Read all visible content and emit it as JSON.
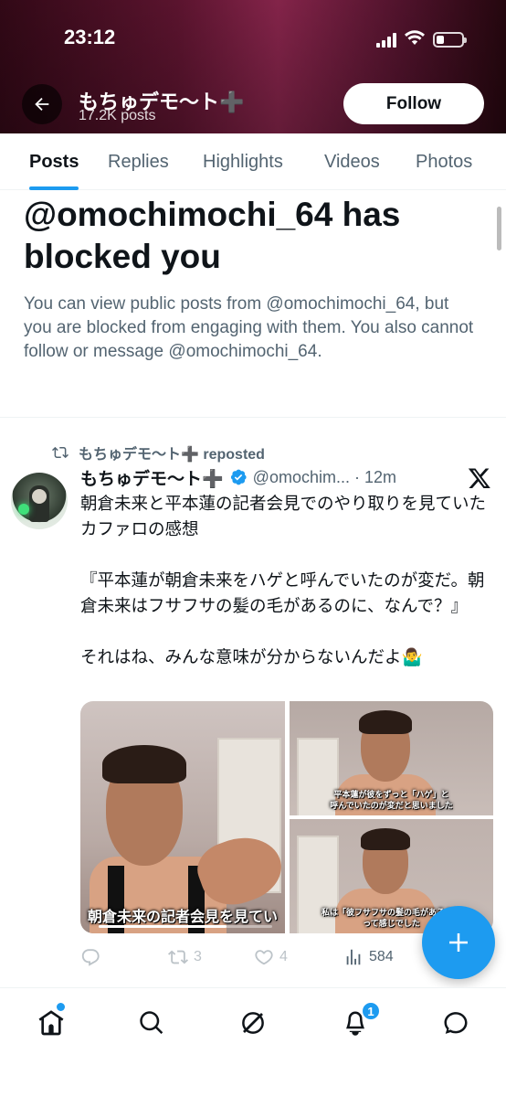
{
  "status_bar": {
    "time": "23:12"
  },
  "header": {
    "profile_name": "もちゅデモ〜ト➕",
    "post_count": "17.2K posts",
    "follow_label": "Follow"
  },
  "tabs": [
    {
      "label": "Posts",
      "active": true
    },
    {
      "label": "Replies",
      "active": false
    },
    {
      "label": "Highlights",
      "active": false
    },
    {
      "label": "Videos",
      "active": false
    },
    {
      "label": "Photos",
      "active": false
    }
  ],
  "blocked": {
    "title": "@omochimochi_64 has blocked you",
    "description": "You can view public posts from @omochimochi_64, but you are blocked from engaging with them. You also cannot follow or message @omochimochi_64."
  },
  "tweet": {
    "repost_label": "もちゅデモ〜ト➕ reposted",
    "author_name": "もちゅデモ〜ト➕",
    "handle_time": "@omochim... · 12m",
    "text": "朝倉未来と平本蓮の記者会見でのやり取りを見ていたカファロの感想\n\n『平本蓮が朝倉未来をハゲと呼んでいたのが変だ。朝倉未来はフサフサの髪の毛があるのに、なんで？』\n\nそれはね、みんな意味が分からないんだよ🤷‍♂️",
    "media": {
      "main_caption": "朝倉未来の記者会見を見てい",
      "top_right_caption_1": "平本蓮が彼をずっと「ハゲ」と",
      "top_right_caption_2": "呼んでいたのが変だと思いました",
      "bottom_right_caption_1": "私は「彼フサフサの髪の毛があるのに",
      "bottom_right_caption_2": "って感じでした"
    },
    "reposts": "3",
    "likes": "4",
    "views": "584"
  },
  "bottom_nav": {
    "notification_count": "1"
  },
  "colors": {
    "accent": "#1d9bf0",
    "text_primary": "#0f1419",
    "text_secondary": "#536471"
  }
}
